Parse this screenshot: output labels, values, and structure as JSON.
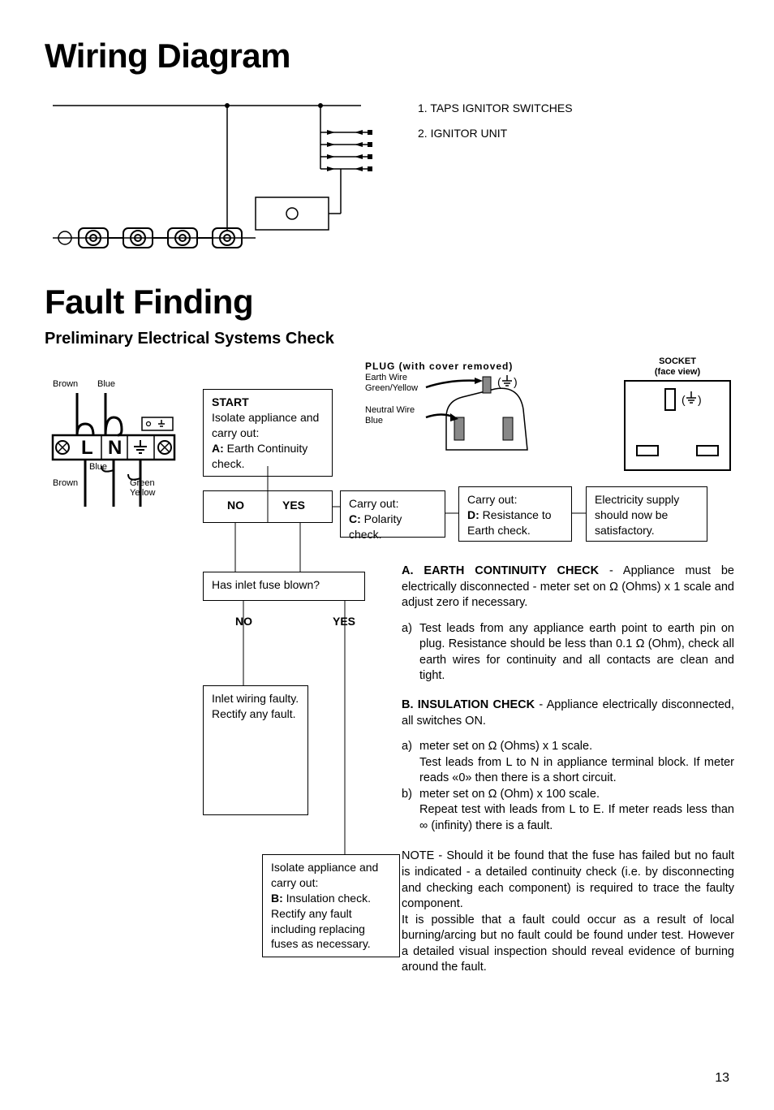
{
  "title1": "Wiring Diagram",
  "legend": {
    "item1": "1. TAPS IGNITOR SWITCHES",
    "item2": "2. IGNITOR UNIT"
  },
  "title2": "Fault Finding",
  "subtitle": "Preliminary Electrical Systems Check",
  "plug": {
    "title": "PLUG (with cover removed)",
    "earth": "Earth Wire",
    "earthcolor": "Green/Yellow",
    "neutral": "Neutral Wire",
    "neutralcolor": "Blue"
  },
  "socket": {
    "title": "SOCKET",
    "sub": "(face view)"
  },
  "tblock": {
    "brown1": "Brown",
    "blue1": "Blue",
    "blue2": "Blue",
    "brown2": "Brown",
    "greenyellow": "Green\nYellow",
    "L": "L",
    "N": "N"
  },
  "boxes": {
    "start_title": "START",
    "start_body1": "Isolate appliance and carry out:",
    "start_body2a": "A:",
    "start_body2b": " Earth Continuity check.",
    "no1": "NO",
    "yes1": "YES",
    "c_body1": "Carry out:",
    "c_body2a": "C:",
    "c_body2b": " Polarity check.",
    "d_body1": "Carry out:",
    "d_body2a": "D:",
    "d_body2b": " Resistance to Earth check.",
    "e_body": "Electricity supply should now be satisfactory.",
    "fuse": "Has inlet fuse blown?",
    "no2": "NO",
    "yes2": "YES",
    "inlet": "Inlet wiring faulty.\nRectify any fault.",
    "isolate1": "Isolate appliance and carry out:",
    "isolate2a": "B:",
    "isolate2b": " Insulation check.",
    "isolate3": "Rectify any fault including replacing fuses as necessary."
  },
  "notes": {
    "a_title": "A. EARTH CONTINUITY CHECK",
    "a_intro": " - Appliance must be electrically disconnected - meter set on Ω (Ohms) x 1 scale and adjust zero if necessary.",
    "a_a": "Test leads from any appliance earth point to earth pin on plug. Resistance should be less than 0.1 Ω (Ohm), check all earth wires for continuity and all contacts are clean and tight.",
    "b_title": "B. INSULATION CHECK",
    "b_intro": " - Appliance electrically disconnected, all switches ON.",
    "b_a": "meter set on Ω (Ohms) x 1 scale.\nTest leads from L to N in appliance terminal block. If meter reads «0» then there is a short circuit.",
    "b_b": "meter set on Ω (Ohm) x 100 scale.\nRepeat test with leads from L to E. If meter reads less than ∞ (infinity) there is a fault.",
    "note1": "NOTE - Should it be found that the fuse has failed but no fault is indicated - a detailed continuity check (i.e. by disconnecting and checking each component) is required to trace the faulty component.",
    "note2": "It is possible that a fault could occur as a result of local burning/arcing but no fault could be found under test. However a detailed visual inspection should reveal evidence of burning around the fault."
  },
  "page": "13"
}
